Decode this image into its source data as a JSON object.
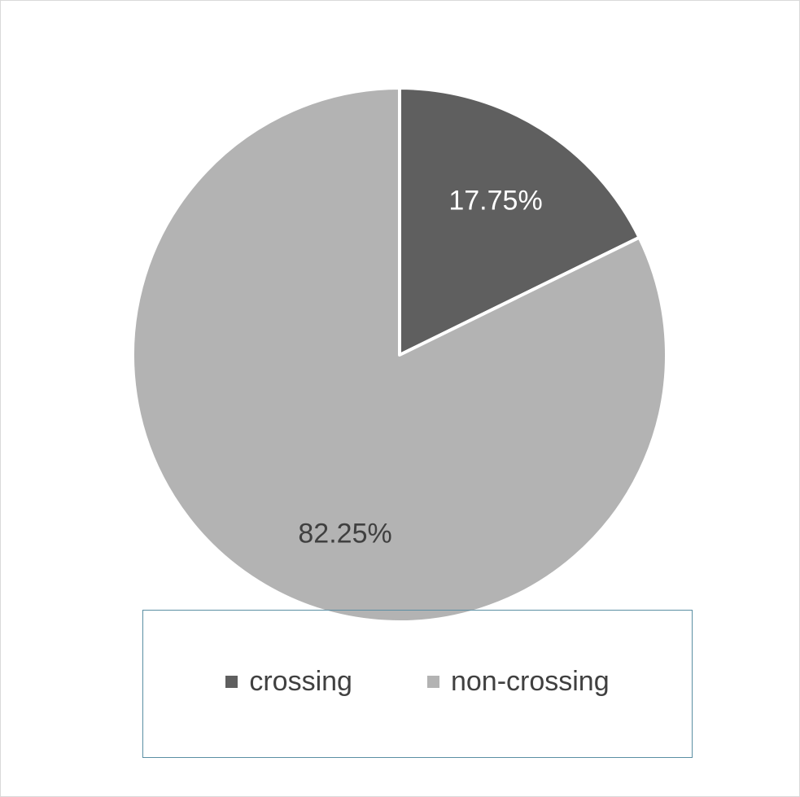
{
  "chart_data": {
    "type": "pie",
    "title": "",
    "slices": [
      {
        "label": "crossing",
        "value": 17.75,
        "display": "17.75%",
        "color": "#5f5f5f",
        "label_color": "#ffffff"
      },
      {
        "label": "non-crossing",
        "value": 82.25,
        "display": "82.25%",
        "color": "#b3b3b3",
        "label_color": "#404040"
      }
    ],
    "start_angle_deg": 0,
    "direction": "clockwise",
    "legend": {
      "placement": "bottom",
      "items": [
        {
          "label": "crossing",
          "color": "#5f5f5f"
        },
        {
          "label": "non-crossing",
          "color": "#b3b3b3"
        }
      ]
    }
  }
}
